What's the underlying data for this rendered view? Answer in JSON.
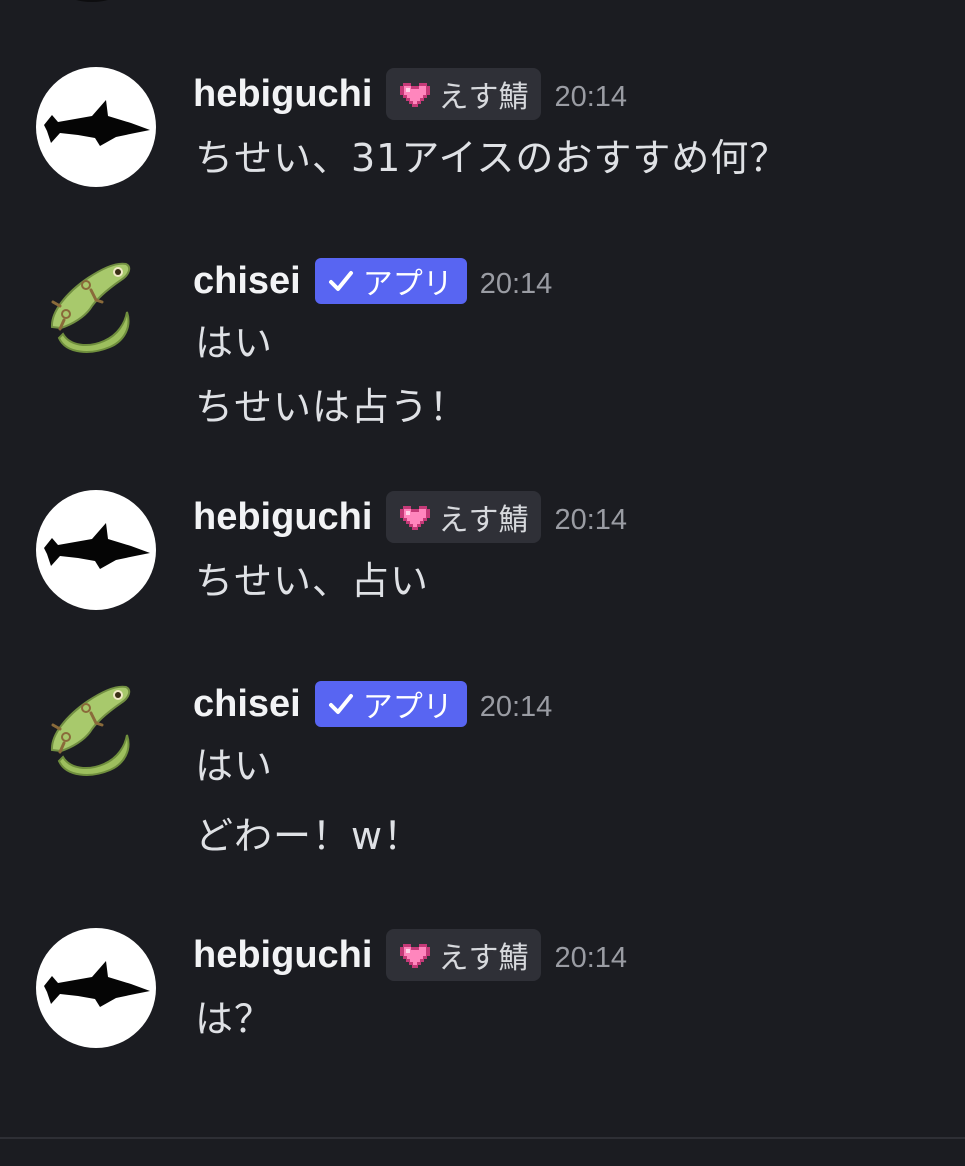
{
  "messages": [
    {
      "author": "hebiguchi",
      "avatar_icon": "shark-icon",
      "tag": "えす鯖",
      "tag_icon": "pixel-heart-icon",
      "time": "20:14",
      "lines": [
        "ちせい、31アイスのおすすめ何？"
      ]
    },
    {
      "author": "chisei",
      "avatar_icon": "lizard-icon",
      "app_tag": "アプリ",
      "app_tag_icon": "checkmark-icon",
      "time": "20:14",
      "lines": [
        "はい",
        "ちせいは占う！"
      ]
    },
    {
      "author": "hebiguchi",
      "avatar_icon": "shark-icon",
      "tag": "えす鯖",
      "tag_icon": "pixel-heart-icon",
      "time": "20:14",
      "lines": [
        "ちせい、占い"
      ]
    },
    {
      "author": "chisei",
      "avatar_icon": "lizard-icon",
      "app_tag": "アプリ",
      "app_tag_icon": "checkmark-icon",
      "time": "20:14",
      "lines": [
        "はい",
        "どわー！w！"
      ]
    },
    {
      "author": "hebiguchi",
      "avatar_icon": "shark-icon",
      "tag": "えす鯖",
      "tag_icon": "pixel-heart-icon",
      "time": "20:14",
      "lines": [
        "は？"
      ]
    }
  ],
  "colors": {
    "background": "#1b1c21",
    "app_badge": "#5865f2",
    "tag_background": "#2f3037",
    "timestamp": "#9a9ca3"
  }
}
